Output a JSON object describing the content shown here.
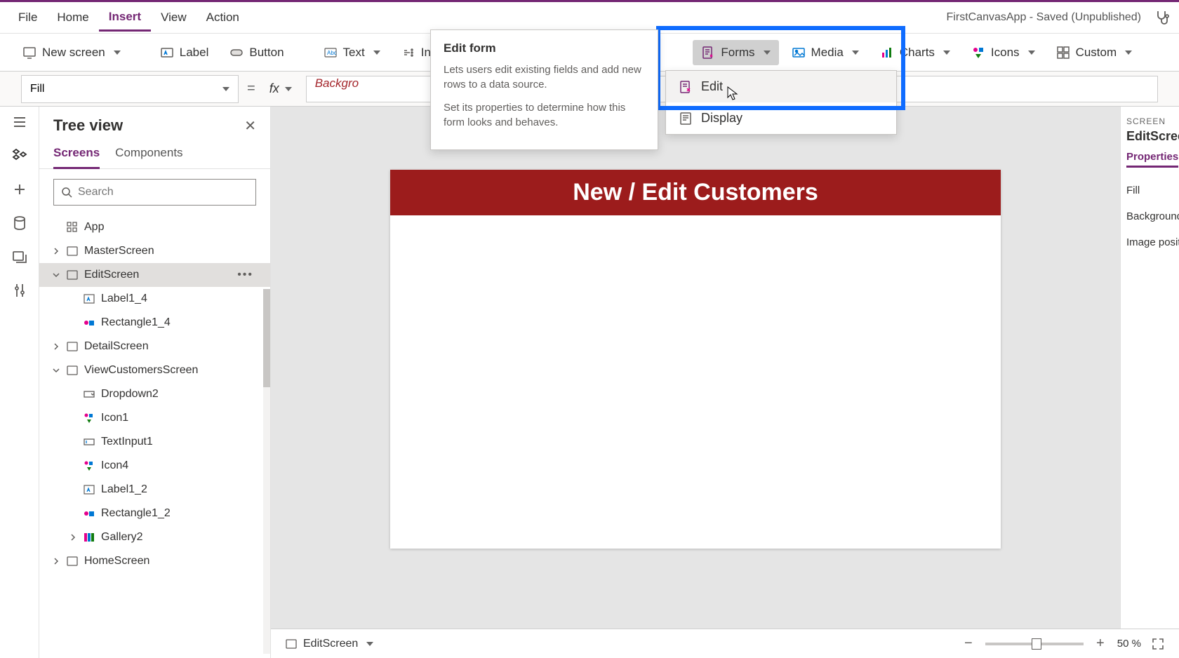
{
  "menu": {
    "file": "File",
    "home": "Home",
    "insert": "Insert",
    "view": "View",
    "action": "Action"
  },
  "app_status": "FirstCanvasApp - Saved (Unpublished)",
  "ribbon": {
    "new_screen": "New screen",
    "label": "Label",
    "button": "Button",
    "text": "Text",
    "inp": "Inp",
    "forms": "Forms",
    "media": "Media",
    "charts": "Charts",
    "icons": "Icons",
    "custom": "Custom"
  },
  "forms_menu": {
    "edit": "Edit",
    "display": "Display"
  },
  "tooltip": {
    "title": "Edit form",
    "body1": "Lets users edit existing fields and add new rows to a data source.",
    "body2": "Set its properties to determine how this form looks and behaves."
  },
  "prop_bar": {
    "selected": "Fill",
    "formula": "Backgro"
  },
  "tree": {
    "title": "Tree view",
    "tab_screens": "Screens",
    "tab_components": "Components",
    "search_placeholder": "Search",
    "items": {
      "app": "App",
      "master": "MasterScreen",
      "edit": "EditScreen",
      "label14": "Label1_4",
      "rect14": "Rectangle1_4",
      "detail": "DetailScreen",
      "view": "ViewCustomersScreen",
      "dropdown2": "Dropdown2",
      "icon1": "Icon1",
      "textinput1": "TextInput1",
      "icon4": "Icon4",
      "label12": "Label1_2",
      "rect12": "Rectangle1_2",
      "gallery2": "Gallery2",
      "home": "HomeScreen"
    }
  },
  "canvas": {
    "header_title": "New / Edit Customers"
  },
  "properties": {
    "screen_label": "SCREEN",
    "screen_name": "EditScreen",
    "tab": "Properties",
    "fill": "Fill",
    "background": "Background",
    "image_pos": "Image positi"
  },
  "footer": {
    "breadcrumb": "EditScreen",
    "zoom": "50",
    "zoom_pct": "%"
  }
}
